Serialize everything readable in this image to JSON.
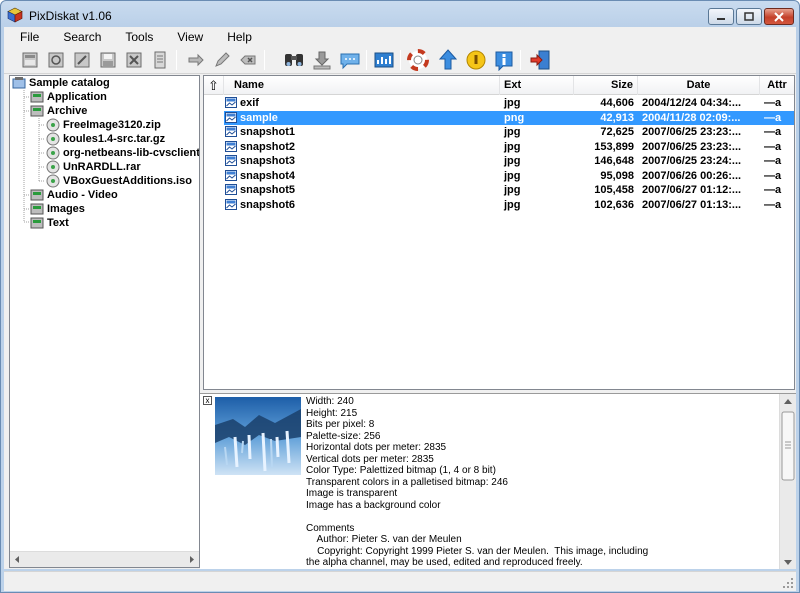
{
  "window": {
    "title": "PixDiskat v1.06"
  },
  "menu": [
    "File",
    "Search",
    "Tools",
    "View",
    "Help"
  ],
  "toolbar": [
    {
      "icon": "catalog-new-icon"
    },
    {
      "icon": "catalog-scan-icon"
    },
    {
      "icon": "catalog-edit-icon"
    },
    {
      "icon": "catalog-save-icon"
    },
    {
      "icon": "catalog-delete-icon"
    },
    {
      "icon": "catalog-properties-icon"
    },
    {
      "icon": "move-item-icon"
    },
    {
      "icon": "rename-item-icon"
    },
    {
      "icon": "remove-item-icon"
    },
    {
      "icon": "search-binoculars-icon"
    },
    {
      "icon": "download-icon"
    },
    {
      "icon": "comment-icon"
    },
    {
      "icon": "statistics-icon"
    },
    {
      "icon": "help-lifebuoy-icon"
    },
    {
      "icon": "update-arrow-icon"
    },
    {
      "icon": "info-coin-icon"
    },
    {
      "icon": "about-info-icon"
    },
    {
      "icon": "exit-door-icon"
    }
  ],
  "tree": {
    "root": "Sample catalog",
    "items": [
      {
        "label": "Application",
        "level": 1
      },
      {
        "label": "Archive",
        "level": 1
      },
      {
        "label": "FreeImage3120.zip",
        "level": 2
      },
      {
        "label": "koules1.4-src.tar.gz",
        "level": 2
      },
      {
        "label": "org-netbeans-lib-cvsclient.j",
        "level": 2
      },
      {
        "label": "UnRARDLL.rar",
        "level": 2
      },
      {
        "label": "VBoxGuestAdditions.iso",
        "level": 2
      },
      {
        "label": "Audio - Video",
        "level": 1
      },
      {
        "label": "Images",
        "level": 1
      },
      {
        "label": "Text",
        "level": 1
      }
    ]
  },
  "list": {
    "up_symbol": "⇧",
    "columns": {
      "name": "Name",
      "ext": "Ext",
      "size": "Size",
      "date": "Date",
      "attr": "Attr"
    },
    "rows": [
      {
        "name": "exif",
        "ext": "jpg",
        "size": "44,606",
        "date": "2004/12/24 04:34:...",
        "attr": "—a"
      },
      {
        "name": "sample",
        "ext": "png",
        "size": "42,913",
        "date": "2004/11/28 02:09:...",
        "attr": "—a",
        "selected": true
      },
      {
        "name": "snapshot1",
        "ext": "jpg",
        "size": "72,625",
        "date": "2007/06/25 23:23:...",
        "attr": "—a"
      },
      {
        "name": "snapshot2",
        "ext": "jpg",
        "size": "153,899",
        "date": "2007/06/25 23:23:...",
        "attr": "—a"
      },
      {
        "name": "snapshot3",
        "ext": "jpg",
        "size": "146,648",
        "date": "2007/06/25 23:24:...",
        "attr": "—a"
      },
      {
        "name": "snapshot4",
        "ext": "jpg",
        "size": "95,098",
        "date": "2007/06/26 00:26:...",
        "attr": "—a"
      },
      {
        "name": "snapshot5",
        "ext": "jpg",
        "size": "105,458",
        "date": "2007/06/27 01:12:...",
        "attr": "—a"
      },
      {
        "name": "snapshot6",
        "ext": "jpg",
        "size": "102,636",
        "date": "2007/06/27 01:13:...",
        "attr": "—a"
      }
    ]
  },
  "preview": {
    "close_symbol": "x",
    "info_lines": [
      "Width: 240",
      "Height: 215",
      "Bits per pixel: 8",
      "Palette-size: 256",
      "Horizontal dots per meter: 2835",
      "Vertical dots per meter: 2835",
      "Color Type: Palettized bitmap (1, 4 or 8 bit)",
      "Transparent colors in a palletised bitmap: 246",
      "Image is transparent",
      "Image has a background color",
      "",
      "Comments",
      "    Author: Pieter S. van der Meulen",
      "    Copyright: Copyright 1999 Pieter S. van der Meulen.  This image, including",
      "the alpha channel, may be used, edited and reproduced freely."
    ]
  }
}
